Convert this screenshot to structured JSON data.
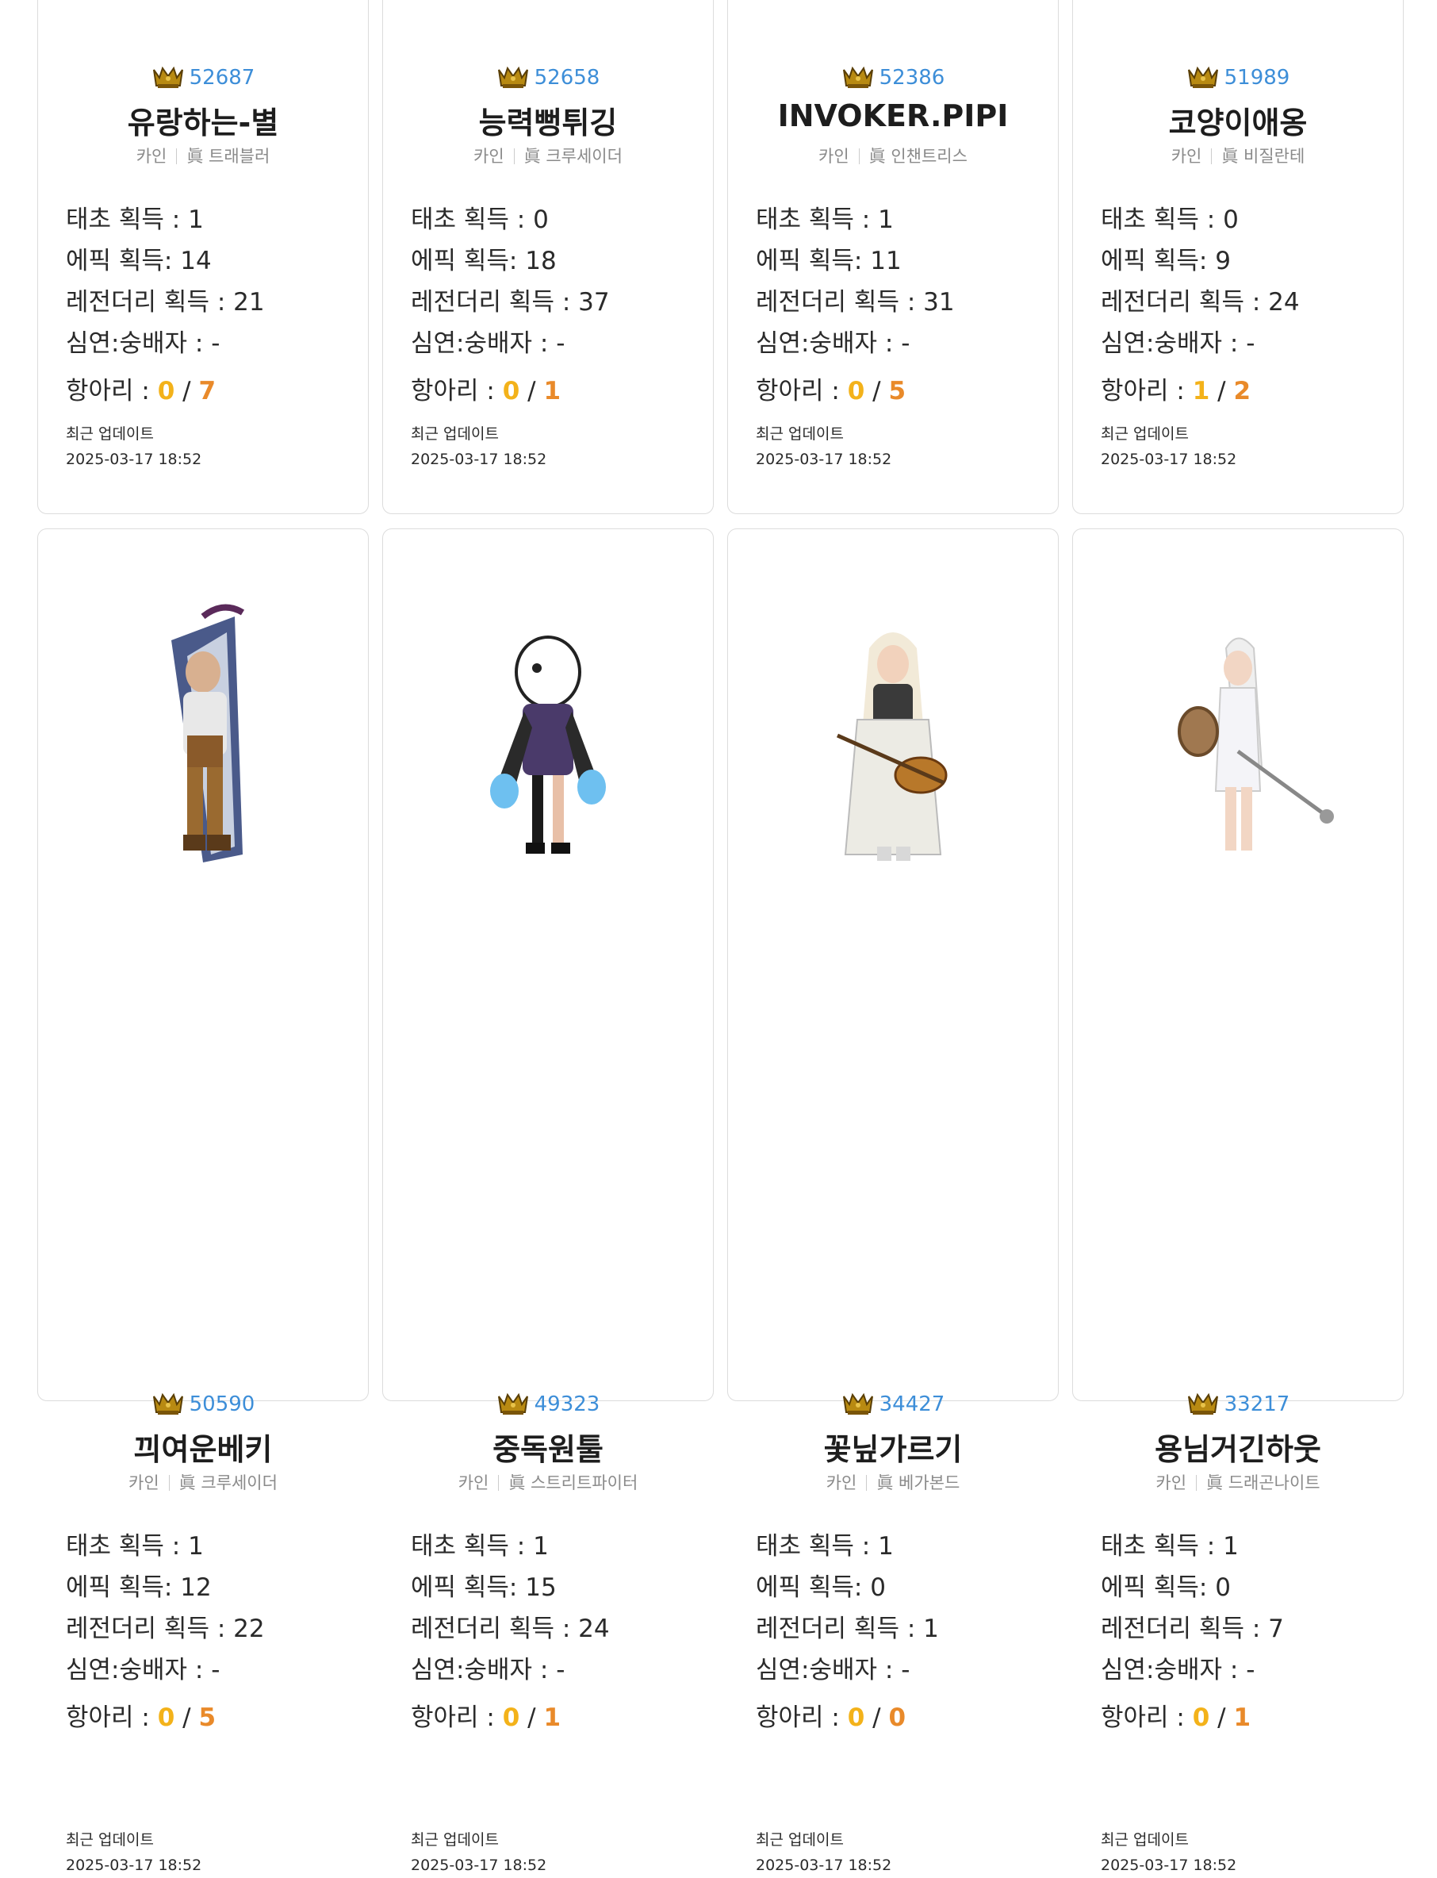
{
  "labels": {
    "taecho": "태초 획득 : ",
    "epic": "에픽 획득: ",
    "legendary": "레전더리 획득 : ",
    "simyeon": "심연:숭배자 : ",
    "hangari": "항아리 : ",
    "slash": " / ",
    "updated": "최근 업데이트"
  },
  "colors": {
    "score": "#3d8ed8",
    "hangari_first": "#f3b21a",
    "hangari_second": "#e98a2a"
  },
  "cards": [
    {
      "score": "52687",
      "name": "유랑하는-별",
      "server": "카인",
      "job": "眞 트래블러",
      "taecho": "1",
      "epic": "14",
      "legendary": "21",
      "simyeon": "-",
      "hang_a": "0",
      "hang_b": "7",
      "updated_at": "2025-03-17 18:52"
    },
    {
      "score": "52658",
      "name": "능력뻥튀깅",
      "server": "카인",
      "job": "眞 크루세이더",
      "taecho": "0",
      "epic": "18",
      "legendary": "37",
      "simyeon": "-",
      "hang_a": "0",
      "hang_b": "1",
      "updated_at": "2025-03-17 18:52"
    },
    {
      "score": "52386",
      "name": "INVOKER.PIPI",
      "server": "카인",
      "job": "眞 인챈트리스",
      "taecho": "1",
      "epic": "11",
      "legendary": "31",
      "simyeon": "-",
      "hang_a": "0",
      "hang_b": "5",
      "updated_at": "2025-03-17 18:52"
    },
    {
      "score": "51989",
      "name": "코양이애옹",
      "server": "카인",
      "job": "眞 비질란테",
      "taecho": "0",
      "epic": "9",
      "legendary": "24",
      "simyeon": "-",
      "hang_a": "1",
      "hang_b": "2",
      "updated_at": "2025-03-17 18:52"
    },
    {
      "score": "50590",
      "name": "끠여운베키",
      "server": "카인",
      "job": "眞 크루세이더",
      "taecho": "1",
      "epic": "12",
      "legendary": "22",
      "simyeon": "-",
      "hang_a": "0",
      "hang_b": "5",
      "updated_at": "2025-03-17 18:52"
    },
    {
      "score": "49323",
      "name": "중독원툴",
      "server": "카인",
      "job": "眞 스트리트파이터",
      "taecho": "1",
      "epic": "15",
      "legendary": "24",
      "simyeon": "-",
      "hang_a": "0",
      "hang_b": "1",
      "updated_at": "2025-03-17 18:52"
    },
    {
      "score": "34427",
      "name": "꽃닢가르기",
      "server": "카인",
      "job": "眞 베가본드",
      "taecho": "1",
      "epic": "0",
      "legendary": "1",
      "simyeon": "-",
      "hang_a": "0",
      "hang_b": "0",
      "updated_at": "2025-03-17 18:52"
    },
    {
      "score": "33217",
      "name": "용님거긴하웃",
      "server": "카인",
      "job": "眞 드래곤나이트",
      "taecho": "1",
      "epic": "0",
      "legendary": "7",
      "simyeon": "-",
      "hang_a": "0",
      "hang_b": "1",
      "updated_at": "2025-03-17 18:52"
    }
  ]
}
